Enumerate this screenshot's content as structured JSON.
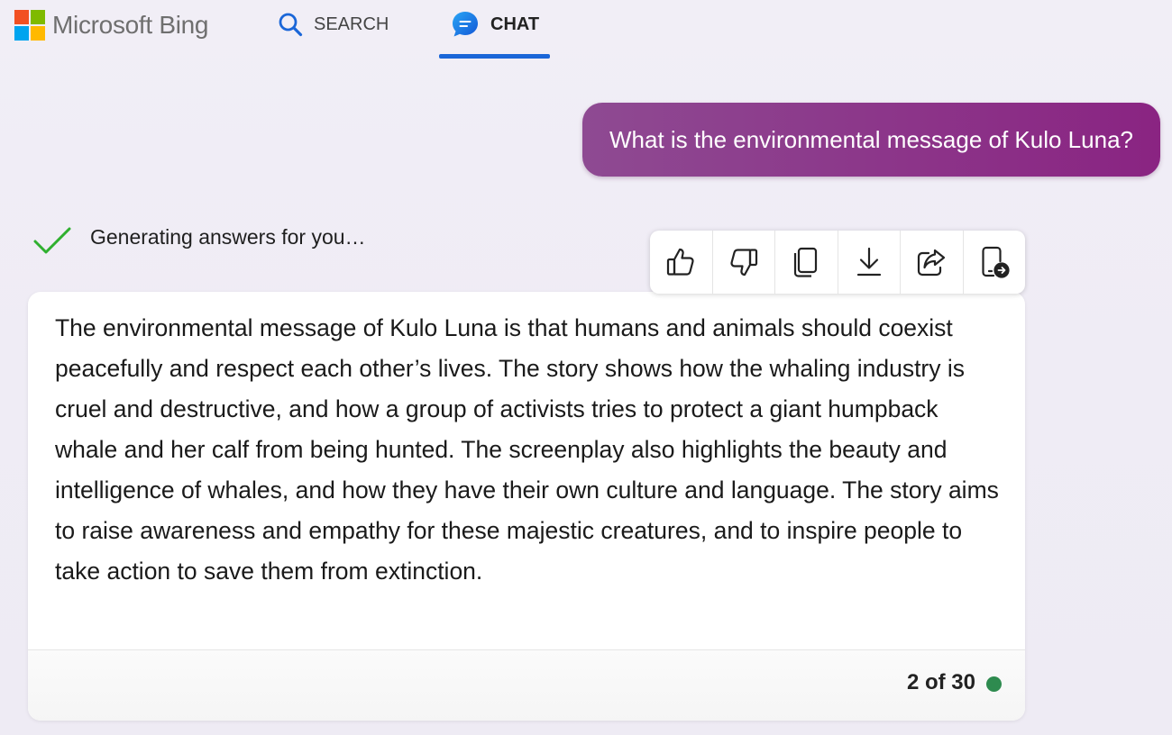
{
  "brand": {
    "name": "Microsoft Bing",
    "logo_colors": [
      "#f25022",
      "#7fba00",
      "#00a4ef",
      "#ffb900"
    ]
  },
  "nav": {
    "search_label": "SEARCH",
    "chat_label": "CHAT",
    "active_tab": "chat",
    "accent_color": "#1a66d8"
  },
  "user_message": {
    "text": "What is the environmental message of Kulo Luna?",
    "bubble_colors": [
      "#8e4a92",
      "#8a2482"
    ]
  },
  "status": {
    "text": "Generating answers for you…",
    "check_color": "#2fb02f"
  },
  "toolbar": {
    "buttons": [
      {
        "name": "like",
        "icon": "thumbs-up-icon"
      },
      {
        "name": "dislike",
        "icon": "thumbs-down-icon"
      },
      {
        "name": "copy",
        "icon": "copy-icon"
      },
      {
        "name": "export",
        "icon": "download-icon"
      },
      {
        "name": "share",
        "icon": "share-icon"
      },
      {
        "name": "continue-on-phone",
        "icon": "phone-transfer-icon"
      }
    ]
  },
  "answer": {
    "text": "The environmental message of Kulo Luna is that humans and animals should coexist peacefully and respect each other’s lives. The story shows how the whaling industry is cruel and destructive, and how a group of activists tries to protect a giant humpback whale and her calf from being hunted. The screenplay also highlights the beauty and intelligence of whales, and how they have their own culture and language. The story aims to raise awareness and empathy for these majestic creatures, and to inspire people to take action to save them from extinction."
  },
  "footer": {
    "turn_counter": "2 of 30",
    "status_dot_color": "#2e8b4f"
  }
}
